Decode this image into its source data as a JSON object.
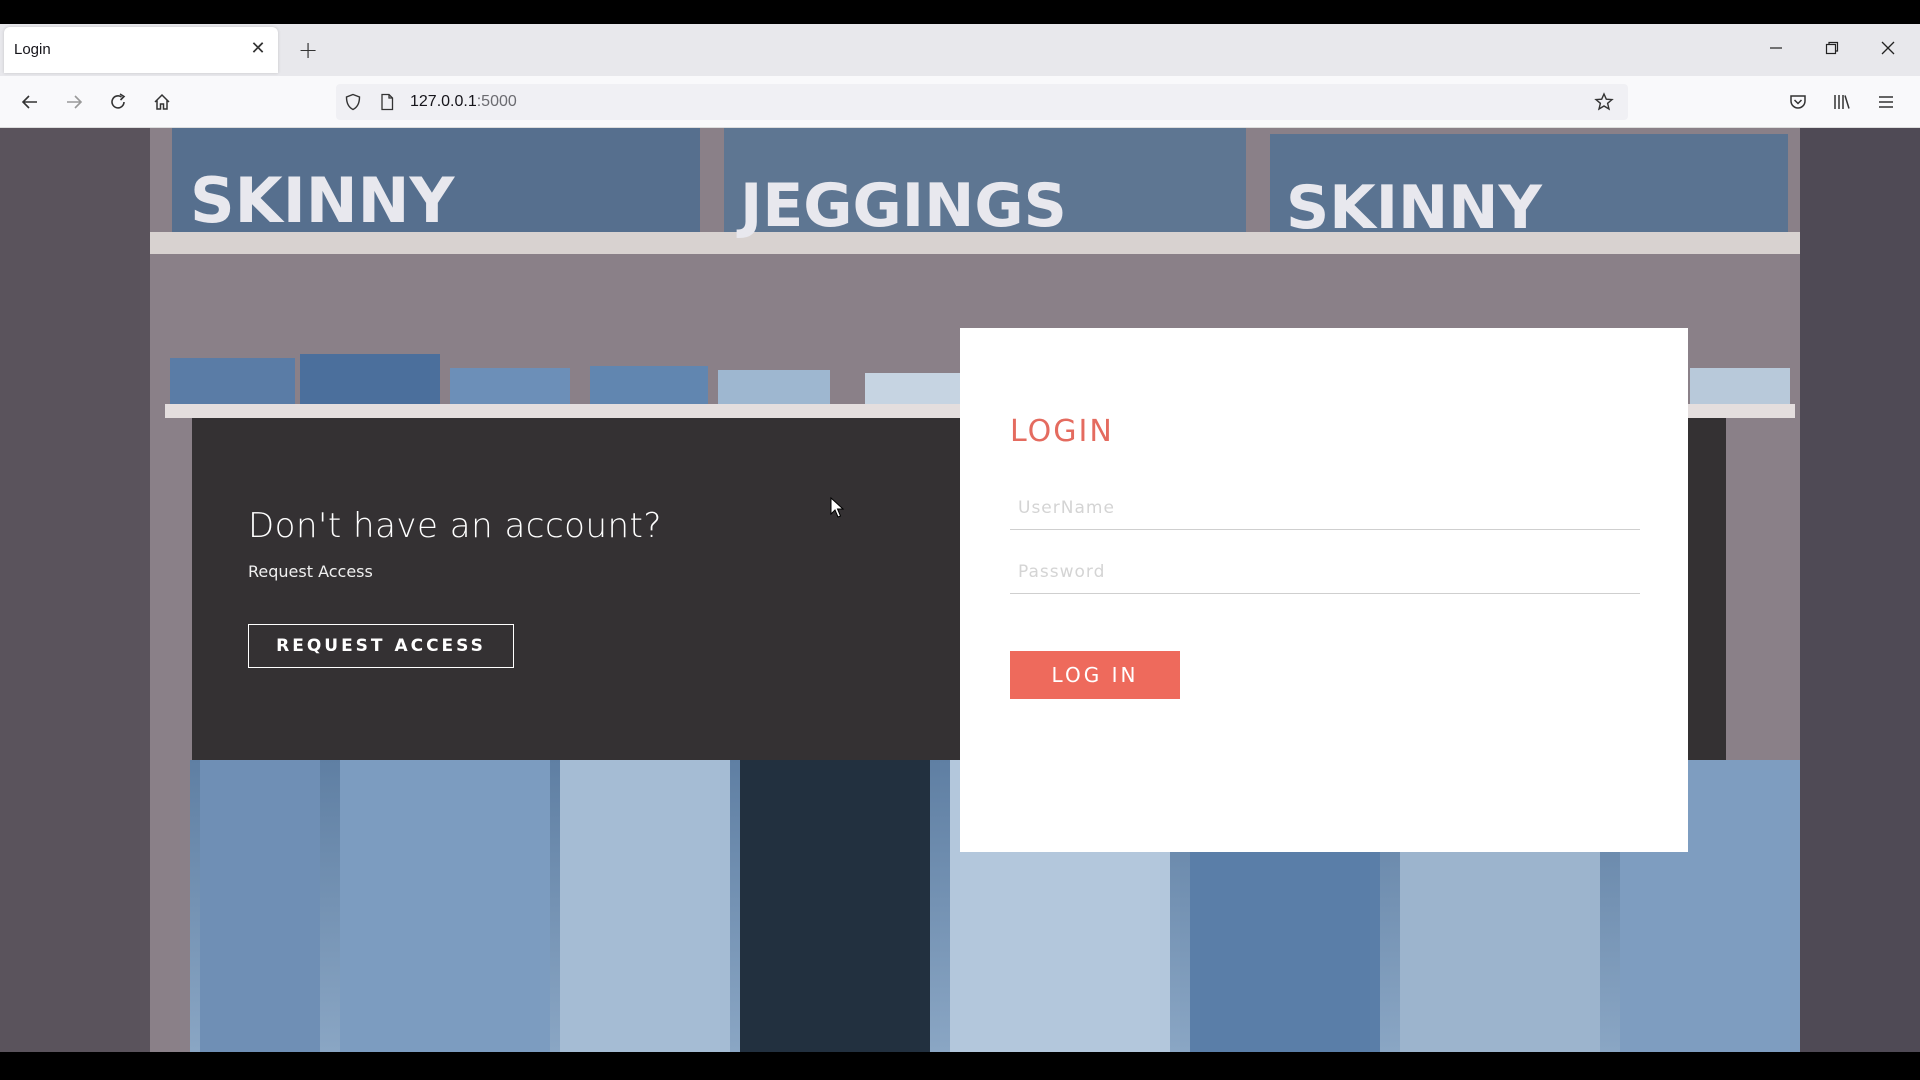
{
  "browser": {
    "tab": {
      "title": "Login"
    },
    "url": {
      "host": "127.0.0.1",
      "port": ":5000"
    }
  },
  "background": {
    "signs": [
      "SKINNY",
      "JEGGINGS",
      "SKINNY"
    ]
  },
  "overlay": {
    "heading": "Don't have an account?",
    "subtext": "Request Access",
    "button_label": "REQUEST ACCESS"
  },
  "login": {
    "title": "LOGIN",
    "username_placeholder": "UserName",
    "password_placeholder": "Password",
    "button_label": "LOG IN"
  },
  "colors": {
    "accent": "#ee6a5c",
    "title": "#e46b5f"
  }
}
